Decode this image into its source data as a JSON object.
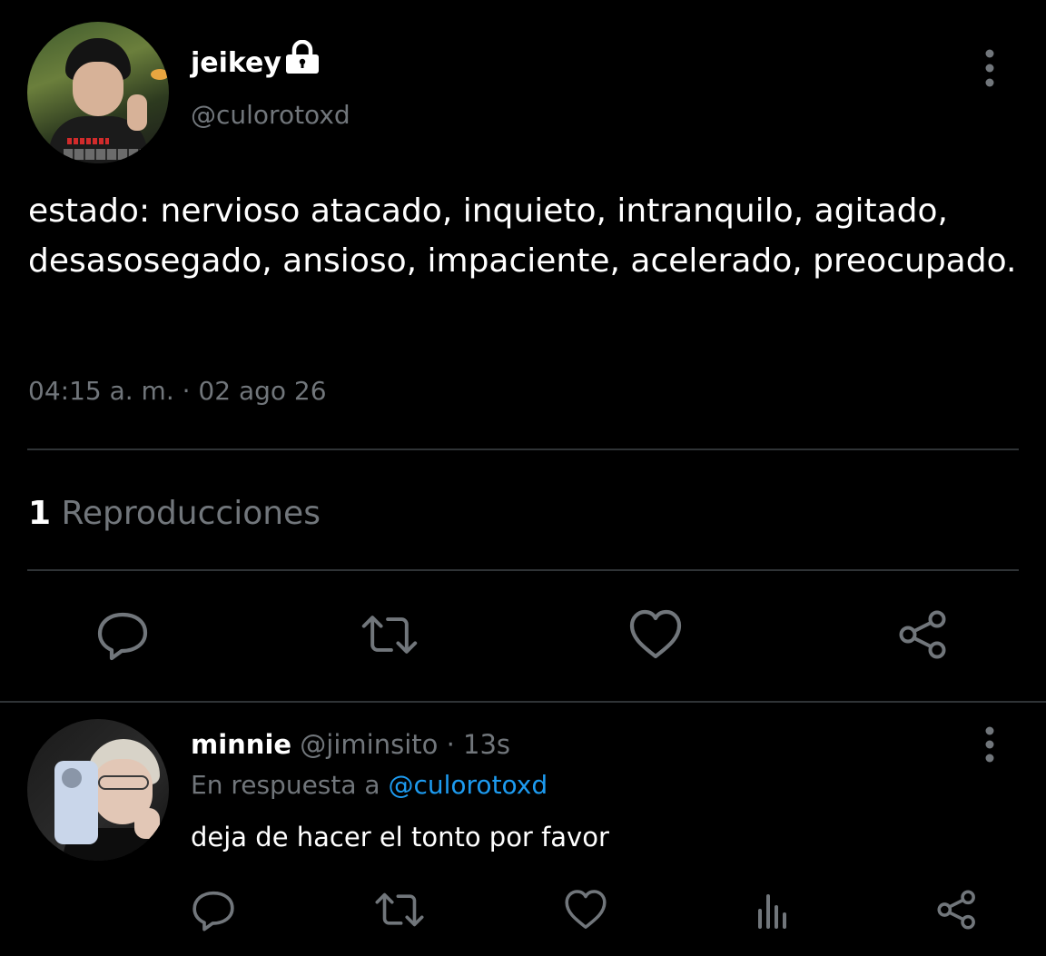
{
  "tweet": {
    "display_name": "jeikey",
    "handle": "@culorotoxd",
    "locked": true,
    "text": "estado: nervioso atacado, inquieto, intranquilo, agitado, desasosegado, ansioso, impaciente, acelerado, preocupado.",
    "timestamp": "04:15 a. m. · 02 ago 26",
    "views_count": "1",
    "views_label": "Reproducciones",
    "actions": [
      "reply-icon",
      "retweet-icon",
      "like-icon",
      "share-icon"
    ]
  },
  "reply": {
    "display_name": "minnie",
    "handle": "@jiminsito",
    "separator": "·",
    "time": "13s",
    "in_reply_prefix": "En respuesta a",
    "in_reply_handle": "@culorotoxd",
    "text": "deja de hacer el tonto por favor",
    "actions": [
      "reply-icon",
      "retweet-icon",
      "like-icon",
      "views-icon",
      "share-icon"
    ]
  },
  "colors": {
    "background": "#000000",
    "primary_text": "#ffffff",
    "secondary_text": "#71767b",
    "accent": "#1d9bf0",
    "divider": "#2f3336"
  }
}
